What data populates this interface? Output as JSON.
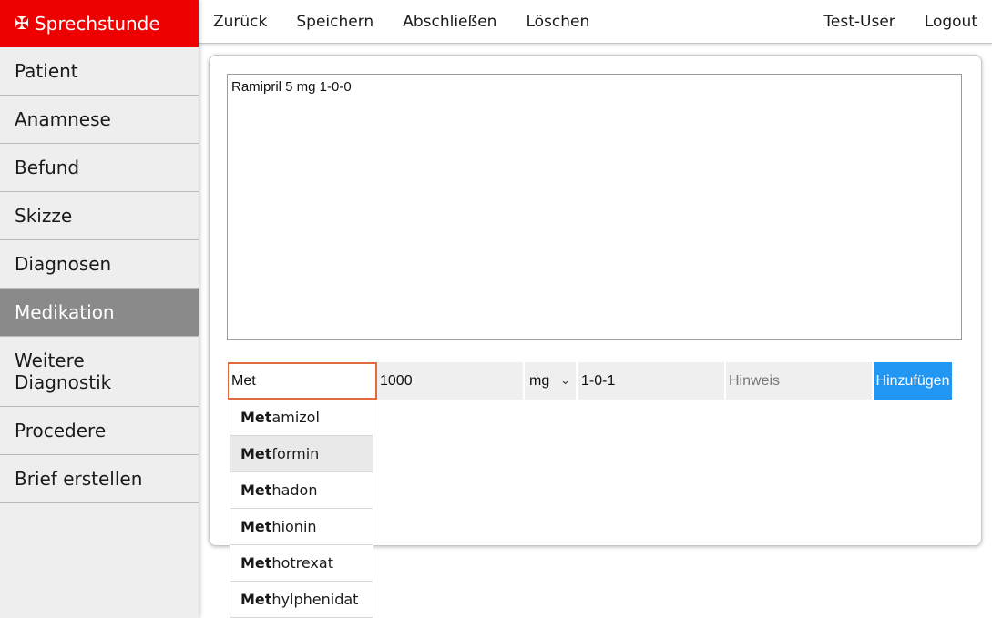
{
  "app": {
    "title": "Sprechstunde",
    "logo_icon": "cross-icon",
    "logo_glyph": "✠"
  },
  "sidebar": {
    "items": [
      {
        "label": "Patient"
      },
      {
        "label": "Anamnese"
      },
      {
        "label": "Befund"
      },
      {
        "label": "Skizze"
      },
      {
        "label": "Diagnosen"
      },
      {
        "label": "Medikation",
        "active": true
      },
      {
        "label": "Weitere Diagnostik"
      },
      {
        "label": "Procedere"
      },
      {
        "label": "Brief erstellen"
      }
    ]
  },
  "topbar": {
    "back": "Zurück",
    "save": "Speichern",
    "finish": "Abschließen",
    "delete": "Löschen",
    "user": "Test-User",
    "logout": "Logout"
  },
  "medication": {
    "text": "Ramipril 5 mg 1-0-0",
    "name_value": "Met",
    "dose_value": "1000",
    "unit_value": "mg",
    "frequency_value": "1-0-1",
    "hint_placeholder": "Hinweis",
    "add_label": "Hinzufügen",
    "suggestions": [
      {
        "match": "Met",
        "rest": "amizol"
      },
      {
        "match": "Met",
        "rest": "formin",
        "highlighted": true
      },
      {
        "match": "Met",
        "rest": "hadon"
      },
      {
        "match": "Met",
        "rest": "hionin"
      },
      {
        "match": "Met",
        "rest": "hotrexat"
      },
      {
        "match": "Met",
        "rest": "hylphenidat"
      }
    ]
  },
  "colors": {
    "brand": "#ee0000",
    "active_nav": "#8a8a8a",
    "button": "#2196f3",
    "focus_border": "#e06a3c"
  }
}
